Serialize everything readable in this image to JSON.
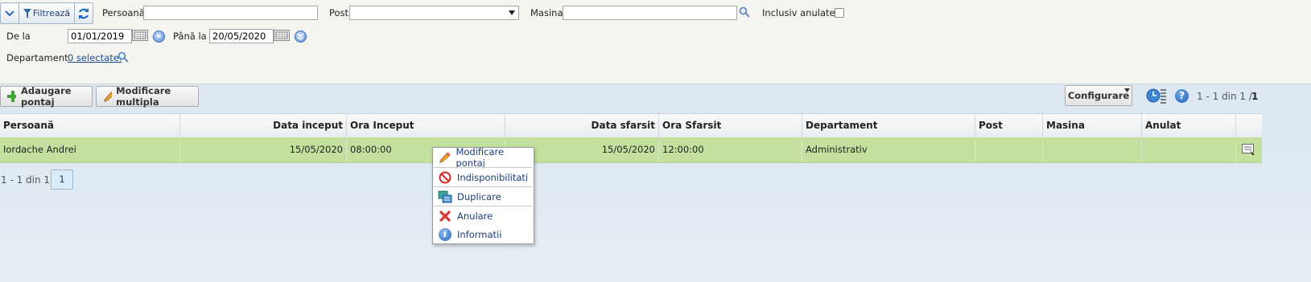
{
  "filters": {
    "filter_button_label": "Filtrează",
    "person_label": "Persoană",
    "person_value": "",
    "post_label": "Post",
    "post_value": "",
    "car_label": "Masina",
    "car_value": "",
    "include_cancelled_label": "Inclusiv anulate",
    "include_cancelled_checked": false,
    "from_label": "De la",
    "from_value": "01/01/2019",
    "to_label": "Până la",
    "to_value": "20/05/2020",
    "department_label": "Departament",
    "department_link": "0 selectate."
  },
  "toolbar": {
    "add_label": "Adaugare pontaj",
    "multi_edit_label": "Modificare multipla",
    "configure_label": "Configurare",
    "pager_text": "1 - 1 din 1 /",
    "pager_total": "1"
  },
  "table": {
    "columns": [
      "Persoană",
      "Data inceput",
      "Ora Inceput",
      "Data sfarsit",
      "Ora Sfarsit",
      "Departament",
      "Post",
      "Masina",
      "Anulat"
    ],
    "rows": [
      {
        "person": "Iordache Andrei",
        "start_date": "15/05/2020",
        "start_time": "08:00:00",
        "end_date": "15/05/2020",
        "end_time": "12:00:00",
        "department": "Administrativ",
        "post": "",
        "car": "",
        "cancelled": ""
      }
    ]
  },
  "context_menu": {
    "items": [
      "Modificare pontaj",
      "Indisponibilitati",
      "Duplicare",
      "Anulare",
      "Informatii"
    ]
  },
  "pagination": {
    "summary": "1 - 1 din 1",
    "current_page": "1"
  },
  "colors": {
    "selected_row": "#c4e09e",
    "menu_text": "#1c3f7a",
    "filter_bg": "#f6f4ee"
  }
}
